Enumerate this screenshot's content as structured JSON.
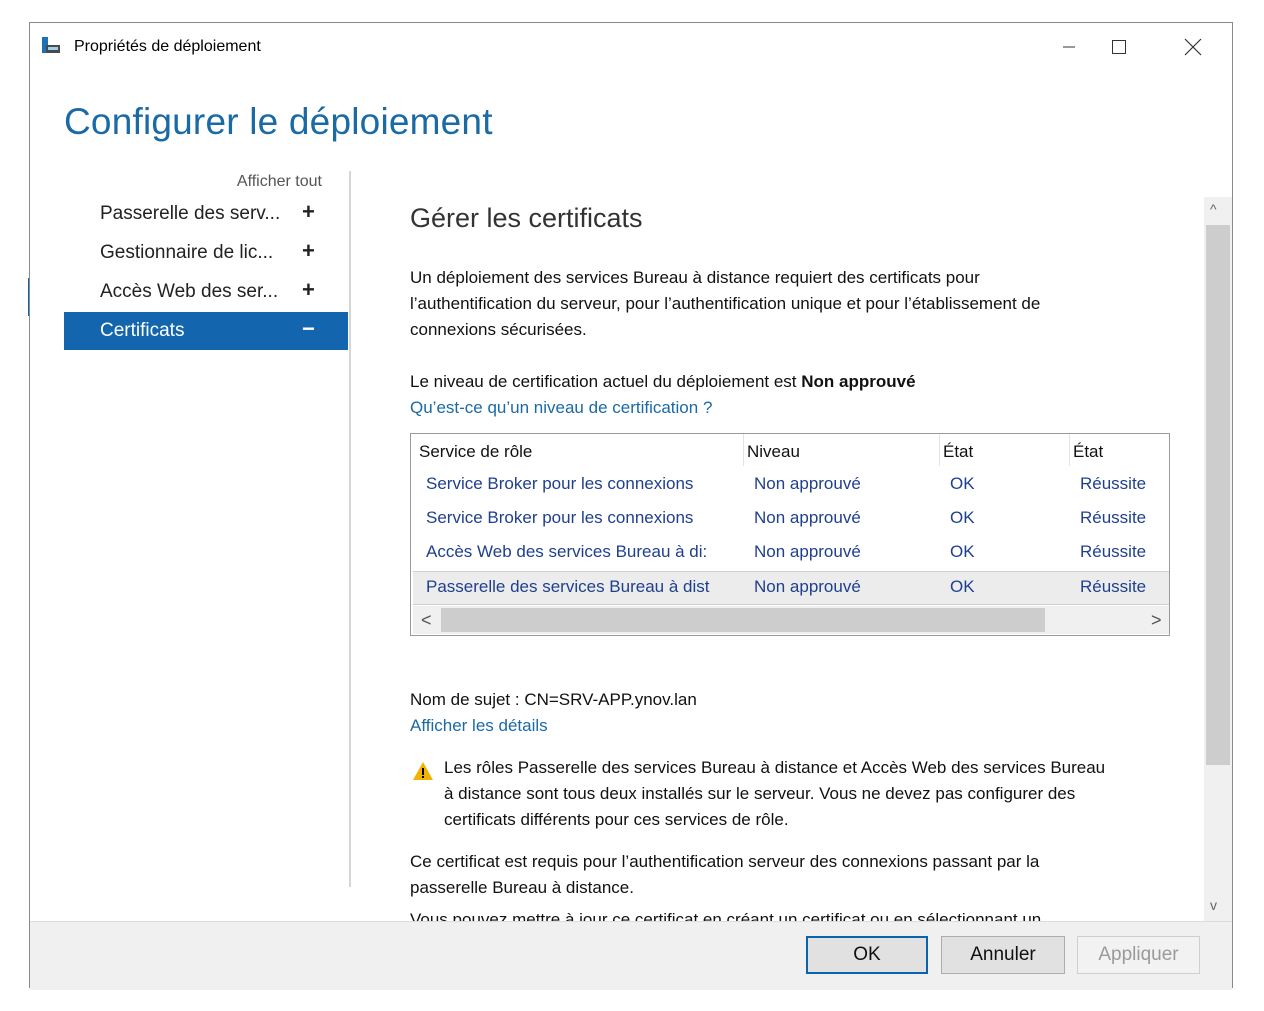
{
  "window": {
    "title": "Propriétés de déploiement"
  },
  "heading": "Configurer le déploiement",
  "nav": {
    "show_all": "Afficher tout",
    "items": [
      {
        "label": "Passerelle des serv...",
        "sign": "+"
      },
      {
        "label": "Gestionnaire de lic...",
        "sign": "+"
      },
      {
        "label": "Accès Web des ser...",
        "sign": "+"
      },
      {
        "label": "Certificats",
        "sign": "−"
      }
    ]
  },
  "content": {
    "title": "Gérer les certificats",
    "intro_line1": "Un déploiement des services Bureau à distance requiert des certificats pour",
    "intro_line2": "l’authentification du serveur, pour l’authentification unique et pour l’établissement de",
    "intro_line3": "connexions sécurisées.",
    "level_text": "Le niveau de certification actuel du déploiement est ",
    "level_value": "Non approuvé",
    "level_link": "Qu’est-ce qu’un niveau de certification ?",
    "table": {
      "headers": [
        "Service de rôle",
        "Niveau",
        "État",
        "État"
      ],
      "rows": [
        [
          "Service Broker pour les connexions",
          "Non approuvé",
          "OK",
          "Réussite"
        ],
        [
          "Service Broker pour les connexions",
          "Non approuvé",
          "OK",
          "Réussite"
        ],
        [
          "Accès Web des services Bureau à di:",
          "Non approuvé",
          "OK",
          "Réussite"
        ],
        [
          "Passerelle des services Bureau à dist",
          "Non approuvé",
          "OK",
          "Réussite"
        ]
      ],
      "scroll_left": "<",
      "scroll_right": ">"
    },
    "subject": "Nom de sujet : CN=SRV-APP.ynov.lan",
    "details_link": "Afficher les détails",
    "warning_line1": "Les rôles Passerelle des services Bureau à distance et Accès Web des services Bureau",
    "warning_line2": "à distance sont tous deux installés sur le serveur. Vous ne devez pas configurer des",
    "warning_line3": "certificats différents pour ces services de rôle.",
    "required_line1": "Ce certificat est requis pour l’authentification serveur des connexions passant par la",
    "required_line2": "passerelle Bureau à distance.",
    "update_line": "Vous pouvez mettre à jour ce certificat en créant un certificat ou en sélectionnant un"
  },
  "vscroll": {
    "up": "^",
    "down": "v"
  },
  "footer": {
    "ok": "OK",
    "cancel": "Annuler",
    "apply": "Appliquer"
  },
  "colors": {
    "accent": "#1366ad",
    "heading": "#1a6aa6",
    "warning": "#f0b400"
  },
  "icons": [
    "app-icon",
    "minimize-icon",
    "maximize-icon",
    "close-icon",
    "warning-icon"
  ]
}
